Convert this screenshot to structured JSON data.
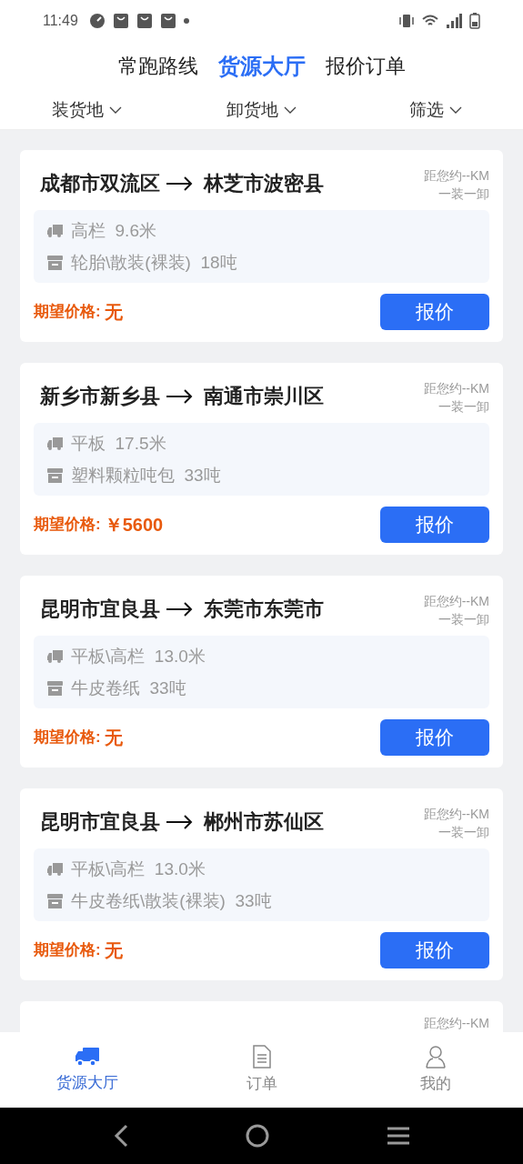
{
  "status_bar": {
    "time": "11:49"
  },
  "top_tabs": [
    {
      "label": "常跑路线",
      "selected": false
    },
    {
      "label": "货源大厅",
      "selected": true
    },
    {
      "label": "报价订单",
      "selected": false
    }
  ],
  "filters": [
    "装货地",
    "卸货地",
    "筛选"
  ],
  "cards": [
    {
      "from": "成都市双流区",
      "to": "林芝市波密县",
      "distance": "距您约--KM",
      "stops": "一装一卸",
      "vehicle": "高栏  9.6米",
      "cargo": "轮胎\\散装(裸装)  18吨",
      "price_label": "期望价格:",
      "price": "无",
      "button": "报价"
    },
    {
      "from": "新乡市新乡县",
      "to": "南通市崇川区",
      "distance": "距您约--KM",
      "stops": "一装一卸",
      "vehicle": "平板  17.5米",
      "cargo": "塑料颗粒吨包  33吨",
      "price_label": "期望价格:",
      "price": "￥5600",
      "button": "报价"
    },
    {
      "from": "昆明市宜良县",
      "to": "东莞市东莞市",
      "distance": "距您约--KM",
      "stops": "一装一卸",
      "vehicle": "平板\\高栏  13.0米",
      "cargo": "牛皮卷纸  33吨",
      "price_label": "期望价格:",
      "price": "无",
      "button": "报价"
    },
    {
      "from": "昆明市宜良县",
      "to": "郴州市苏仙区",
      "distance": "距您约--KM",
      "stops": "一装一卸",
      "vehicle": "平板\\高栏  13.0米",
      "cargo": "牛皮卷纸\\散装(裸装)  33吨",
      "price_label": "期望价格:",
      "price": "无",
      "button": "报价"
    }
  ],
  "partial_card": {
    "distance": "距您约--KM"
  },
  "bottom_tabs": [
    {
      "label": "货源大厅",
      "kind": "truck",
      "selected": true
    },
    {
      "label": "订单",
      "kind": "doc",
      "selected": false
    },
    {
      "label": "我的",
      "kind": "user",
      "selected": false
    }
  ]
}
